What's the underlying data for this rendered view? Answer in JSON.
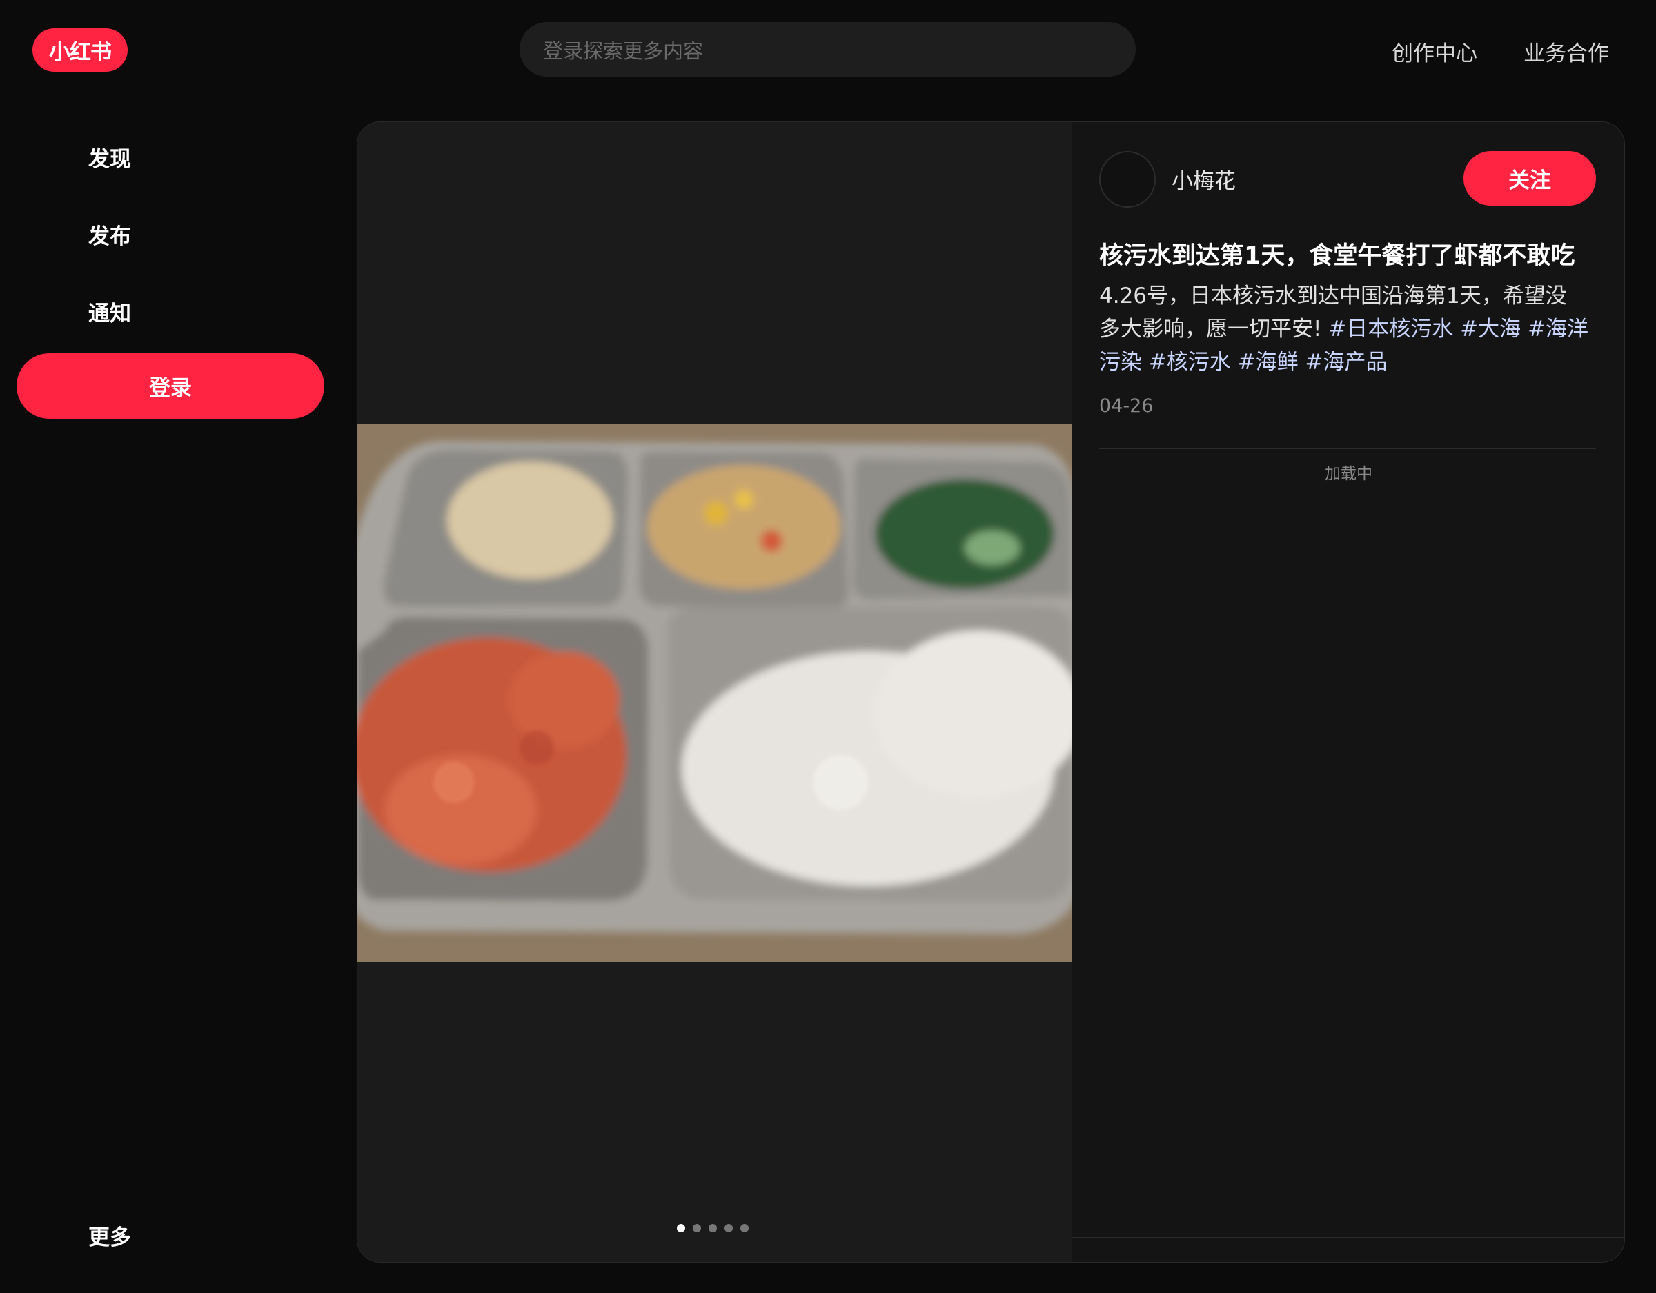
{
  "header": {
    "logo": "小红书",
    "search_placeholder": "登录探索更多内容",
    "nav": [
      "创作中心",
      "业务合作"
    ]
  },
  "sidebar": {
    "items": [
      {
        "label": "发现"
      },
      {
        "label": "发布"
      },
      {
        "label": "通知"
      }
    ],
    "login_label": "登录",
    "more_label": "更多"
  },
  "note": {
    "author": "小梅花",
    "follow_label": "关注",
    "title": "核污水到达第1天，食堂午餐打了虾都不敢吃",
    "desc_line1": "4.26号，日本核污水到达中国沿海第1天，希望没",
    "desc_line2_text": "多大影响，愿一切平安! ",
    "tags": [
      "#日本核污水",
      "#大海",
      "#海洋污染",
      "#核污水",
      "#海鲜",
      "#海产品"
    ],
    "date": "04-26",
    "loading": "加载中",
    "image_count": 5,
    "active_image": 1
  }
}
